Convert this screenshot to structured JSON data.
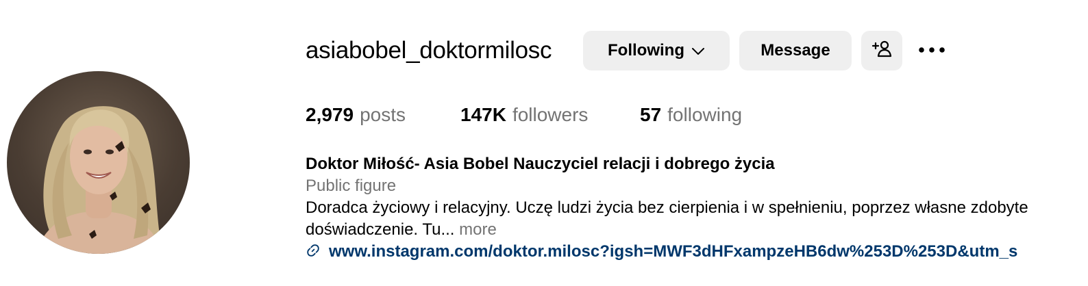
{
  "profile": {
    "username": "asiabobel_doktormilosc",
    "buttons": {
      "following_label": "Following",
      "message_label": "Message"
    },
    "stats": {
      "posts_count": "2,979",
      "posts_label": "posts",
      "followers_count": "147K",
      "followers_label": "followers",
      "following_count": "57",
      "following_label": "following"
    },
    "bio": {
      "full_name": "Doktor Miłość- Asia Bobel Nauczyciel relacji i dobrego życia",
      "category": "Public figure",
      "text": "Doradca życiowy i relacyjny. Uczę ludzi życia bez cierpienia i w spełnieniu, poprzez własne zdobyte doświadczenie. Tu...",
      "more_label": "more",
      "link": "www.instagram.com/doktor.milosc?igsh=MWF3dHFxampzeHB6dw%253D%253D&utm_s"
    }
  },
  "icons": {
    "chevron": "chevron-down-icon",
    "add_user": "add-user-icon",
    "more": "more-horizontal-icon",
    "link": "link-icon"
  },
  "colors": {
    "button_bg": "#efefef",
    "secondary_text": "#737373",
    "link": "#00376b"
  }
}
